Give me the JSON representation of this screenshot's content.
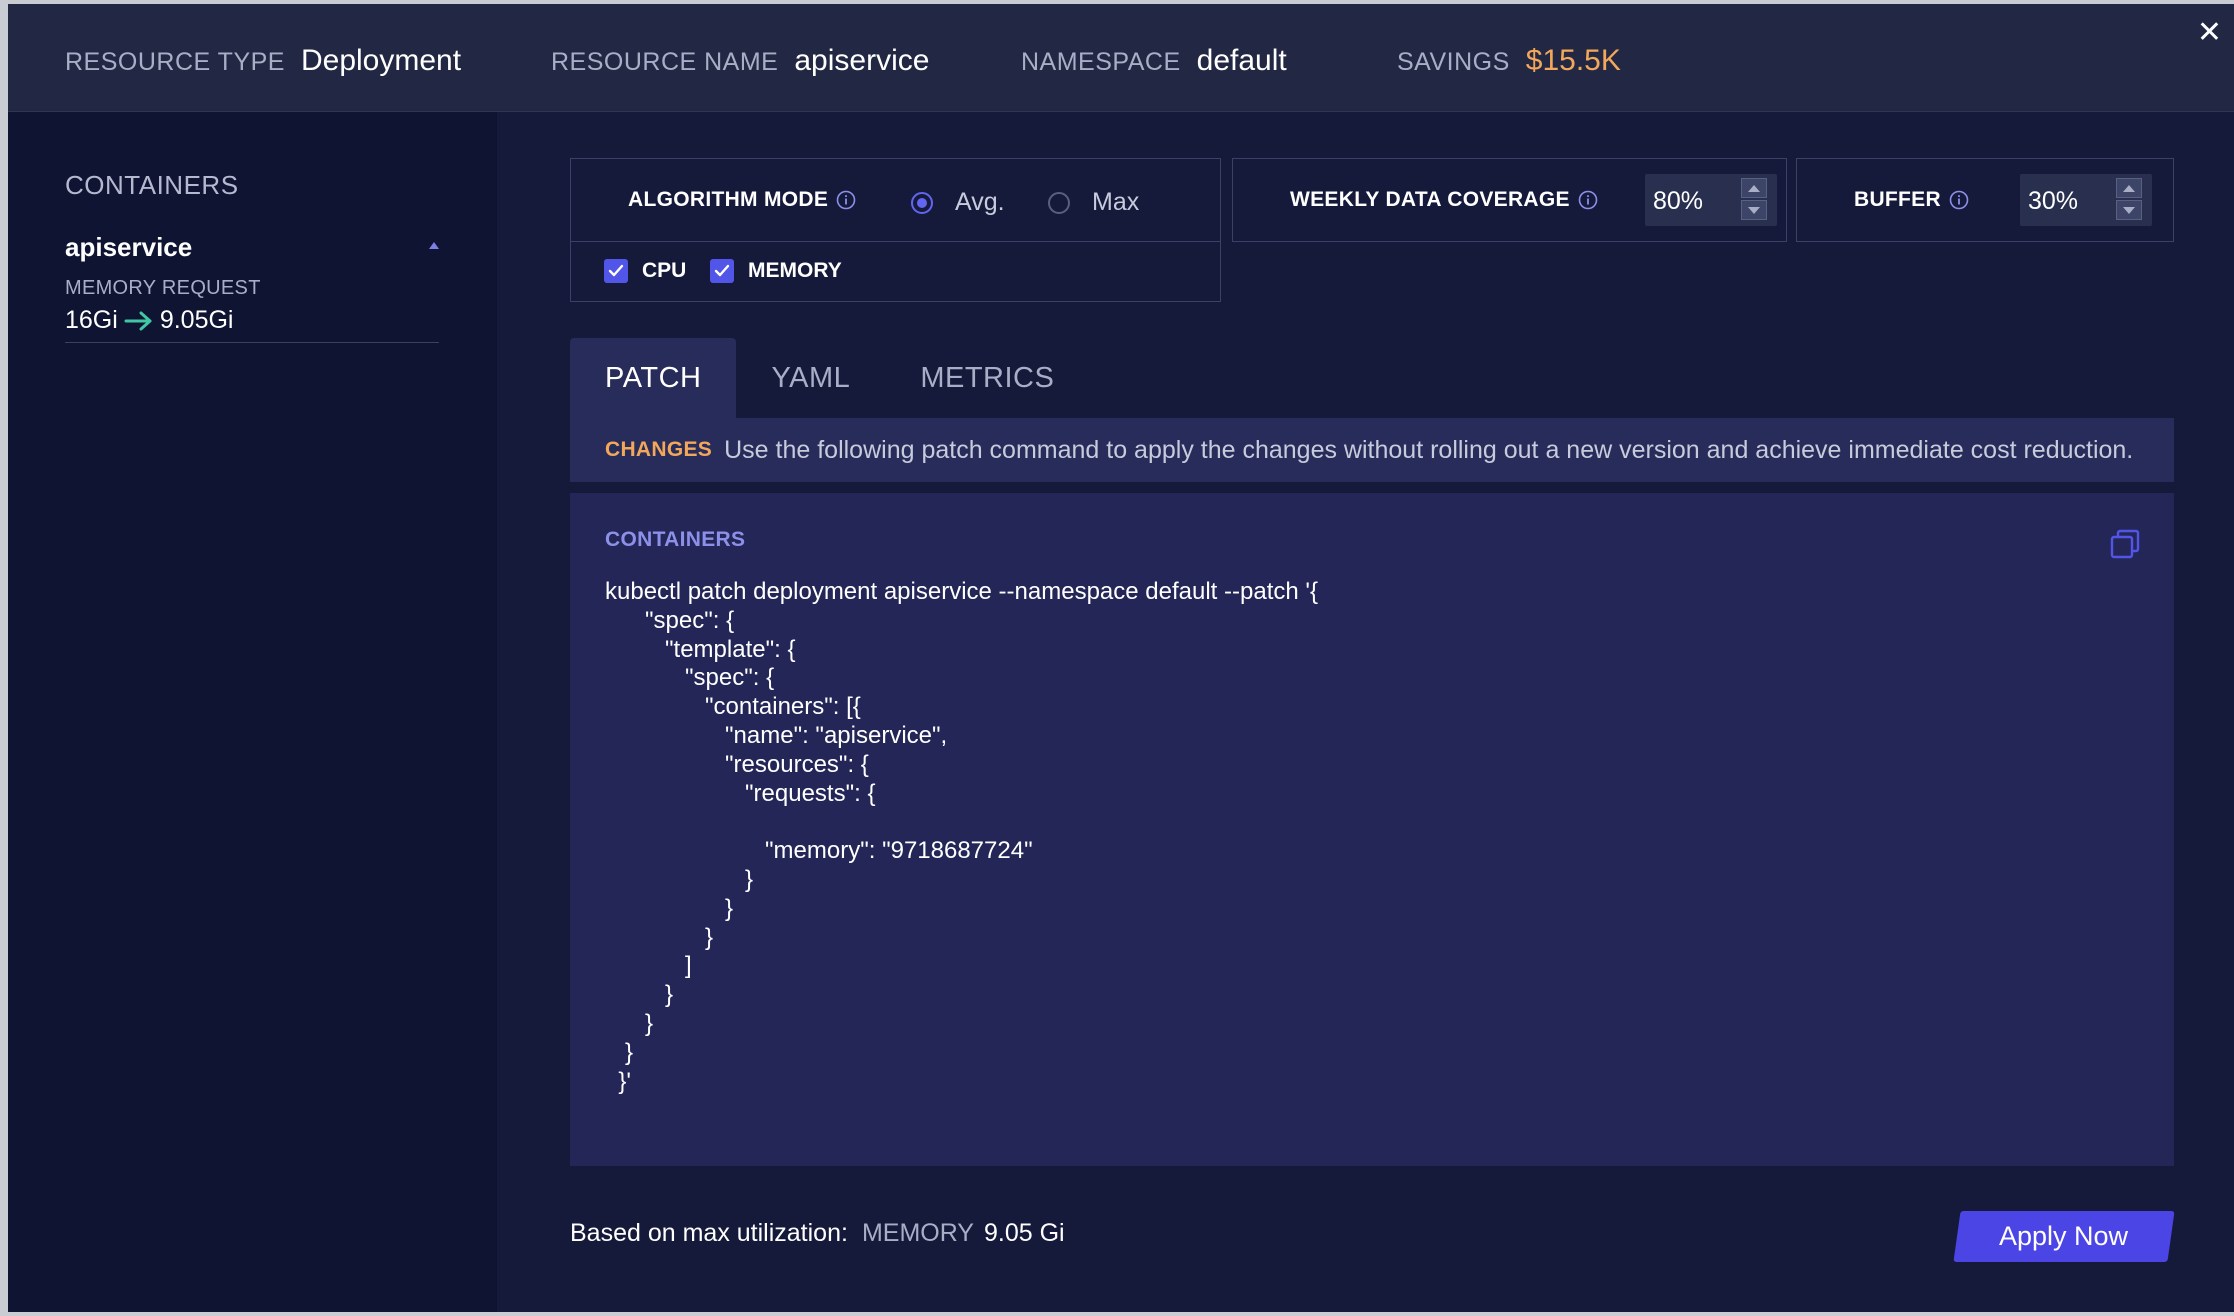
{
  "header": {
    "resource_type_label": "RESOURCE TYPE",
    "resource_type_value": "Deployment",
    "resource_name_label": "RESOURCE NAME",
    "resource_name_value": "apiservice",
    "namespace_label": "NAMESPACE",
    "namespace_value": "default",
    "savings_label": "SAVINGS",
    "savings_value": "$15.5K",
    "close_glyph": "✕"
  },
  "sidebar": {
    "title": "CONTAINERS",
    "containers": [
      {
        "name": "apiservice",
        "metric_label": "MEMORY REQUEST",
        "from": "16Gi",
        "to": "9.05Gi"
      }
    ]
  },
  "settings": {
    "algorithm_label": "ALGORITHM MODE",
    "options": [
      {
        "label": "Avg.",
        "selected": true
      },
      {
        "label": "Max",
        "selected": false
      }
    ],
    "coverage_label": "WEEKLY DATA COVERAGE",
    "coverage_value": "80%",
    "buffer_label": "BUFFER",
    "buffer_value": "30%",
    "resources": [
      {
        "label": "CPU",
        "checked": true
      },
      {
        "label": "MEMORY",
        "checked": true
      }
    ]
  },
  "tabs": [
    {
      "label": "PATCH",
      "active": true
    },
    {
      "label": "YAML",
      "active": false
    },
    {
      "label": "METRICS",
      "active": false
    }
  ],
  "changes": {
    "label": "CHANGES",
    "text": "Use the following patch command to apply the changes without rolling out a new version and achieve immediate cost reduction."
  },
  "code_panel": {
    "title": "CONTAINERS",
    "code": "kubectl patch deployment apiservice --namespace default --patch '{\n      \"spec\": {\n         \"template\": {\n            \"spec\": {\n               \"containers\": [{\n                  \"name\": \"apiservice\",\n                  \"resources\": {\n                     \"requests\": {\n\n                        \"memory\": \"9718687724\"\n                     }\n                  }\n               }\n            ]\n         }\n      }\n   }\n  }'"
  },
  "footer": {
    "label": "Based on max utilization:",
    "resource": "MEMORY",
    "value": "9.05 Gi",
    "apply_label": "Apply Now"
  },
  "colors": {
    "accent": "#5256e8",
    "savings": "#f3a75a",
    "arrow": "#3fc7a6",
    "background": "#0c1230"
  }
}
